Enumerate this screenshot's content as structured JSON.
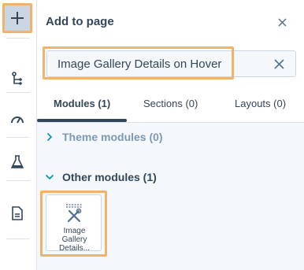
{
  "rail": {
    "items": [
      {
        "name": "add"
      },
      {
        "name": "tree"
      },
      {
        "name": "gauge"
      },
      {
        "name": "flask"
      },
      {
        "name": "page"
      }
    ]
  },
  "panel": {
    "title": "Add to page",
    "search": {
      "value": "Image Gallery Details on Hover"
    },
    "tabs": [
      {
        "label": "Modules (1)",
        "active": true
      },
      {
        "label": "Sections (0)",
        "active": false
      },
      {
        "label": "Layouts (0)",
        "active": false
      }
    ],
    "groups": [
      {
        "label": "Theme modules (0)",
        "expanded": false
      },
      {
        "label": "Other modules (1)",
        "expanded": true
      }
    ],
    "modules": [
      {
        "label_line1": "Image",
        "label_line2": "Gallery",
        "label_line3": "Details..."
      }
    ]
  },
  "colors": {
    "highlight": "#f0b26d",
    "text": "#33475b",
    "muted": "#7c98b6"
  }
}
